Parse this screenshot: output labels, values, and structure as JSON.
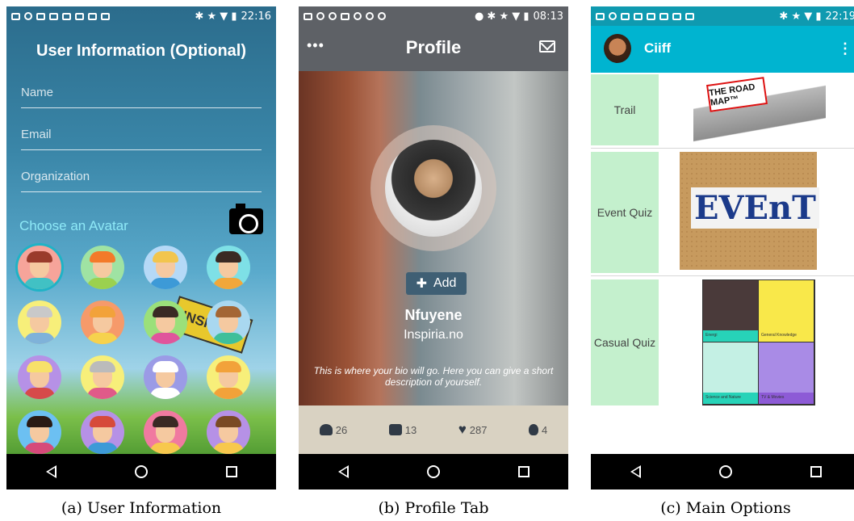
{
  "phone_a": {
    "status_time": "22:16",
    "title": "User Information (Optional)",
    "fields": [
      {
        "placeholder": "Name"
      },
      {
        "placeholder": "Email"
      },
      {
        "placeholder": "Organization"
      }
    ],
    "choose_label": "Choose an Avatar",
    "sign_text": "INSPIRIA",
    "avatars": [
      {
        "bg": "#f6a49a",
        "hair": "#9a3b2b",
        "body": "#41c1c4"
      },
      {
        "bg": "#9fe3a3",
        "hair": "#f37a2a",
        "body": "#9bd14f"
      },
      {
        "bg": "#b5d9f7",
        "hair": "#f2c54d",
        "body": "#3d9ad7"
      },
      {
        "bg": "#7ee0e6",
        "hair": "#3a2a24",
        "body": "#f1a73a"
      },
      {
        "bg": "#f7ef7a",
        "hair": "#c9c9c9",
        "body": "#7fb2d9"
      },
      {
        "bg": "#f69a6a",
        "hair": "#f2a23a",
        "body": "#f6d24d"
      },
      {
        "bg": "#9be07a",
        "hair": "#3a2a24",
        "body": "#e0559c"
      },
      {
        "bg": "#a9d8f0",
        "hair": "#a46634",
        "body": "#3fbf9a"
      },
      {
        "bg": "#b691e6",
        "hair": "#f7e16a",
        "body": "#d64a4a"
      },
      {
        "bg": "#f7ef7a",
        "hair": "#bbbbbb",
        "body": "#e05a89"
      },
      {
        "bg": "#9b9be6",
        "hair": "#ffffff",
        "body": "#ffffff"
      },
      {
        "bg": "#f7ef7a",
        "hair": "#f2a23a",
        "body": "#f2a23a"
      },
      {
        "bg": "#6cc0f2",
        "hair": "#2a1a14",
        "body": "#d64a7a"
      },
      {
        "bg": "#b691e6",
        "hair": "#d64a3a",
        "body": "#3d9ad7"
      },
      {
        "bg": "#f07aa0",
        "hair": "#3a2a24",
        "body": "#f7c84d"
      },
      {
        "bg": "#b691e6",
        "hair": "#7a4a24",
        "body": "#f7c84d"
      }
    ]
  },
  "phone_b": {
    "status_time": "08:13",
    "title": "Profile",
    "add_label": "Add",
    "name": "Nfuyene",
    "org": "Inspiria.no",
    "bio": "This is where your bio will go. Here you can give a short description of yourself.",
    "stats": [
      {
        "icon": "person-icon",
        "value": "26"
      },
      {
        "icon": "comment-icon",
        "value": "13"
      },
      {
        "icon": "heart-icon",
        "value": "287"
      },
      {
        "icon": "drop-icon",
        "value": "4"
      }
    ]
  },
  "phone_c": {
    "status_time": "22:19",
    "title": "Ciiff",
    "rows": [
      {
        "label": "Trail",
        "image": "the-road-map-image",
        "image_text": "THE ROAD MAP™"
      },
      {
        "label": "Event Quiz",
        "image": "event-corkboard-image",
        "image_text": "EVEnT"
      },
      {
        "label": "Casual Quiz",
        "image": "casual-quiz-grid-image"
      }
    ],
    "quiz_tiles": [
      {
        "label": "Energi",
        "color": "#27d3b8"
      },
      {
        "label": "General Knowledge",
        "color": "#f9e84a"
      },
      {
        "label": "Science and Nature",
        "color": "#27d3b8"
      },
      {
        "label": "TV & Movies",
        "color": "#8d5bd6"
      }
    ]
  },
  "captions": [
    "(a) User Information",
    "(b) Profile Tab",
    "(c) Main Options"
  ],
  "colors": {
    "accent_c": "#00b4d0",
    "label_green": "#c4f0cd",
    "header_b": "#5e6166",
    "choose_text": "#8ee9f7"
  }
}
